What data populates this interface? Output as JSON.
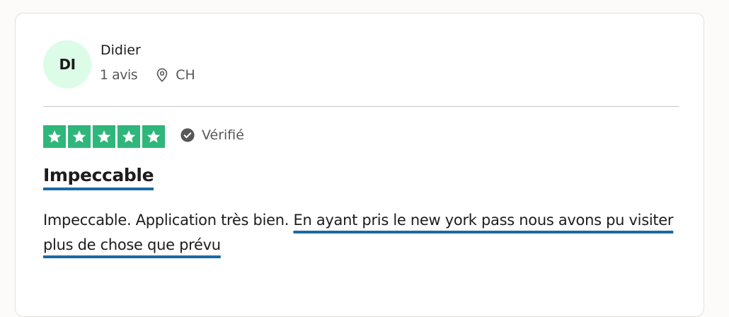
{
  "review": {
    "user": {
      "initials": "DI",
      "name": "Didier",
      "review_count": "1 avis",
      "country": "CH"
    },
    "rating": 5,
    "verified_label": "Vérifié",
    "title": "Impeccable",
    "body_plain": "Impeccable. Application très bien. ",
    "body_highlight": "En ayant pris le new york pass nous avons pu visiter plus de chose que prévu"
  },
  "colors": {
    "star_green": "#2fb67a",
    "avatar_bg": "#dcfce7",
    "underline_blue": "#1a6aa3",
    "muted_text": "#575757"
  },
  "icons": {
    "location": "map-pin-icon",
    "verified": "check-circle-icon",
    "star": "star-icon"
  }
}
